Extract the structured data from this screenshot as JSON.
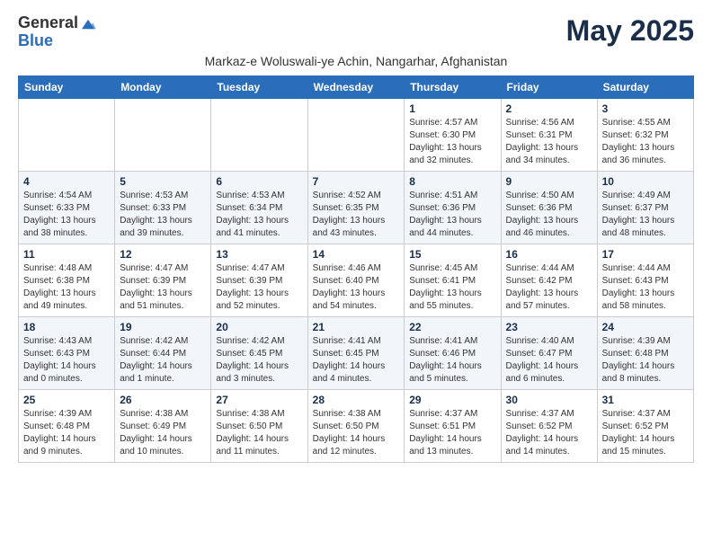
{
  "logo": {
    "general": "General",
    "blue": "Blue"
  },
  "title": "May 2025",
  "subtitle": "Markaz-e Woluswali-ye Achin, Nangarhar, Afghanistan",
  "weekdays": [
    "Sunday",
    "Monday",
    "Tuesday",
    "Wednesday",
    "Thursday",
    "Friday",
    "Saturday"
  ],
  "weeks": [
    [
      {
        "day": "",
        "info": ""
      },
      {
        "day": "",
        "info": ""
      },
      {
        "day": "",
        "info": ""
      },
      {
        "day": "",
        "info": ""
      },
      {
        "day": "1",
        "info": "Sunrise: 4:57 AM\nSunset: 6:30 PM\nDaylight: 13 hours\nand 32 minutes."
      },
      {
        "day": "2",
        "info": "Sunrise: 4:56 AM\nSunset: 6:31 PM\nDaylight: 13 hours\nand 34 minutes."
      },
      {
        "day": "3",
        "info": "Sunrise: 4:55 AM\nSunset: 6:32 PM\nDaylight: 13 hours\nand 36 minutes."
      }
    ],
    [
      {
        "day": "4",
        "info": "Sunrise: 4:54 AM\nSunset: 6:33 PM\nDaylight: 13 hours\nand 38 minutes."
      },
      {
        "day": "5",
        "info": "Sunrise: 4:53 AM\nSunset: 6:33 PM\nDaylight: 13 hours\nand 39 minutes."
      },
      {
        "day": "6",
        "info": "Sunrise: 4:53 AM\nSunset: 6:34 PM\nDaylight: 13 hours\nand 41 minutes."
      },
      {
        "day": "7",
        "info": "Sunrise: 4:52 AM\nSunset: 6:35 PM\nDaylight: 13 hours\nand 43 minutes."
      },
      {
        "day": "8",
        "info": "Sunrise: 4:51 AM\nSunset: 6:36 PM\nDaylight: 13 hours\nand 44 minutes."
      },
      {
        "day": "9",
        "info": "Sunrise: 4:50 AM\nSunset: 6:36 PM\nDaylight: 13 hours\nand 46 minutes."
      },
      {
        "day": "10",
        "info": "Sunrise: 4:49 AM\nSunset: 6:37 PM\nDaylight: 13 hours\nand 48 minutes."
      }
    ],
    [
      {
        "day": "11",
        "info": "Sunrise: 4:48 AM\nSunset: 6:38 PM\nDaylight: 13 hours\nand 49 minutes."
      },
      {
        "day": "12",
        "info": "Sunrise: 4:47 AM\nSunset: 6:39 PM\nDaylight: 13 hours\nand 51 minutes."
      },
      {
        "day": "13",
        "info": "Sunrise: 4:47 AM\nSunset: 6:39 PM\nDaylight: 13 hours\nand 52 minutes."
      },
      {
        "day": "14",
        "info": "Sunrise: 4:46 AM\nSunset: 6:40 PM\nDaylight: 13 hours\nand 54 minutes."
      },
      {
        "day": "15",
        "info": "Sunrise: 4:45 AM\nSunset: 6:41 PM\nDaylight: 13 hours\nand 55 minutes."
      },
      {
        "day": "16",
        "info": "Sunrise: 4:44 AM\nSunset: 6:42 PM\nDaylight: 13 hours\nand 57 minutes."
      },
      {
        "day": "17",
        "info": "Sunrise: 4:44 AM\nSunset: 6:43 PM\nDaylight: 13 hours\nand 58 minutes."
      }
    ],
    [
      {
        "day": "18",
        "info": "Sunrise: 4:43 AM\nSunset: 6:43 PM\nDaylight: 14 hours\nand 0 minutes."
      },
      {
        "day": "19",
        "info": "Sunrise: 4:42 AM\nSunset: 6:44 PM\nDaylight: 14 hours\nand 1 minute."
      },
      {
        "day": "20",
        "info": "Sunrise: 4:42 AM\nSunset: 6:45 PM\nDaylight: 14 hours\nand 3 minutes."
      },
      {
        "day": "21",
        "info": "Sunrise: 4:41 AM\nSunset: 6:45 PM\nDaylight: 14 hours\nand 4 minutes."
      },
      {
        "day": "22",
        "info": "Sunrise: 4:41 AM\nSunset: 6:46 PM\nDaylight: 14 hours\nand 5 minutes."
      },
      {
        "day": "23",
        "info": "Sunrise: 4:40 AM\nSunset: 6:47 PM\nDaylight: 14 hours\nand 6 minutes."
      },
      {
        "day": "24",
        "info": "Sunrise: 4:39 AM\nSunset: 6:48 PM\nDaylight: 14 hours\nand 8 minutes."
      }
    ],
    [
      {
        "day": "25",
        "info": "Sunrise: 4:39 AM\nSunset: 6:48 PM\nDaylight: 14 hours\nand 9 minutes."
      },
      {
        "day": "26",
        "info": "Sunrise: 4:38 AM\nSunset: 6:49 PM\nDaylight: 14 hours\nand 10 minutes."
      },
      {
        "day": "27",
        "info": "Sunrise: 4:38 AM\nSunset: 6:50 PM\nDaylight: 14 hours\nand 11 minutes."
      },
      {
        "day": "28",
        "info": "Sunrise: 4:38 AM\nSunset: 6:50 PM\nDaylight: 14 hours\nand 12 minutes."
      },
      {
        "day": "29",
        "info": "Sunrise: 4:37 AM\nSunset: 6:51 PM\nDaylight: 14 hours\nand 13 minutes."
      },
      {
        "day": "30",
        "info": "Sunrise: 4:37 AM\nSunset: 6:52 PM\nDaylight: 14 hours\nand 14 minutes."
      },
      {
        "day": "31",
        "info": "Sunrise: 4:37 AM\nSunset: 6:52 PM\nDaylight: 14 hours\nand 15 minutes."
      }
    ]
  ]
}
